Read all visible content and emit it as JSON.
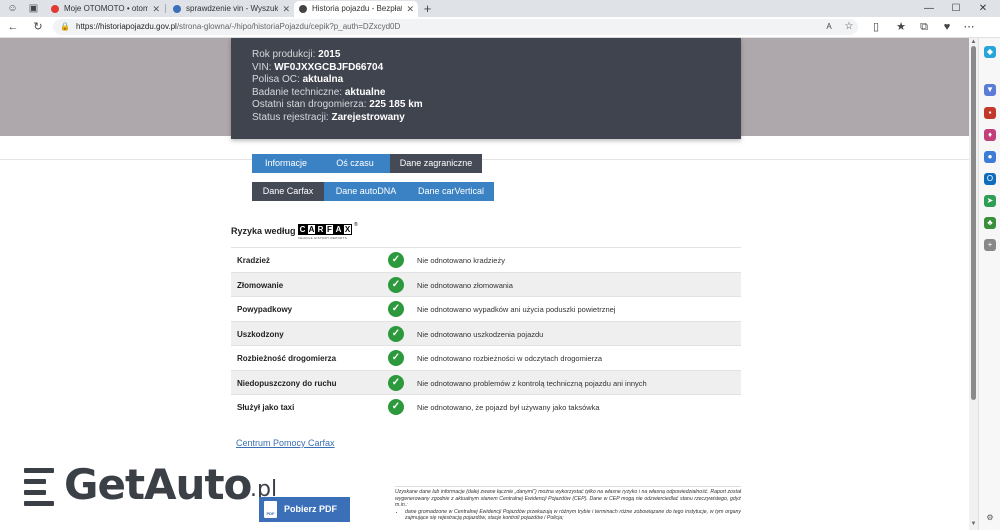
{
  "browser": {
    "tabs": [
      {
        "label": "Moje OTOMOTO • otomoto.pl",
        "fav_color": "#e23a32"
      },
      {
        "label": "sprawdzenie vin - Wyszukaj",
        "fav_color": "#3b6fb8"
      },
      {
        "label": "Historia pojazdu - Bezpłatny rap",
        "fav_color": "#444444"
      }
    ],
    "new_tab_label": "+",
    "url_host": "https://historiapojazdu.gov.pl",
    "url_path": "/strona-glowna/-/hipo/historiaPojazdu/cepik?p_auth=DZxcyd0D"
  },
  "vehicle": {
    "rok_label": "Rok produkcji:",
    "rok_value": "2015",
    "vin_label": "VIN:",
    "vin_value": "WF0JXXGCBJFD66704",
    "polisa_label": "Polisa OC:",
    "polisa_value": "aktualna",
    "badanie_label": "Badanie techniczne:",
    "badanie_value": "aktualne",
    "licznik_label": "Ostatni stan drogomierza:",
    "licznik_value": "225 185 km",
    "status_label": "Status rejestracji:",
    "status_value": "Zarejestrowany"
  },
  "tabs_row1": [
    "Informacje",
    "Oś czasu",
    "Dane zagraniczne"
  ],
  "tabs_row2": [
    "Dane Carfax",
    "Dane autoDNA",
    "Dane carVertical"
  ],
  "risk": {
    "title": "Ryzyka według",
    "carfax_letters": [
      "C",
      "A",
      "R",
      "F",
      "A",
      "X"
    ],
    "carfax_sub": "VEHICLE HISTORY REPORTS",
    "carfax_reg": "®",
    "rows": [
      {
        "name": "Kradzież",
        "desc": "Nie odnotowano kradzieży"
      },
      {
        "name": "Złomowanie",
        "desc": "Nie odnotowano złomowania"
      },
      {
        "name": "Powypadkowy",
        "desc": "Nie odnotowano wypadków ani użycia poduszki powietrznej"
      },
      {
        "name": "Uszkodzony",
        "desc": "Nie odnotowano uszkodzenia pojazdu"
      },
      {
        "name": "Rozbieżność drogomierza",
        "desc": "Nie odnotowano rozbieżności w odczytach drogomierza"
      },
      {
        "name": "Niedopuszczony do ruchu",
        "desc": "Nie odnotowano problemów z kontrolą techniczną pojazdu ani innych"
      },
      {
        "name": "Służył jako taxi",
        "desc": "Nie odnotowano, że pojazd był używany jako taksówka"
      }
    ],
    "check_glyph": "✓"
  },
  "help_link": "Centrum Pomocy Carfax",
  "logo": {
    "text": "GetAuto",
    "suffix": ".pl"
  },
  "pdf": {
    "label": "Pobierz PDF",
    "icon_text": "PDF"
  },
  "disclaimer": {
    "p1": "Uzyskane dane lub informacje (dalej zwane łącznie „danymi\") można wykorzystać tylko na własne ryzyko i na własną odpowiedzialność. Raport został wygenerowany zgodnie z aktualnym stanem Centralnej Ewidencji Pojazdów (CEP). Dane w CEP mogą nie odzwierciedlać stanu rzeczywistego, gdyż m.in.:",
    "li1": "dane gromadzone w Centralnej Ewidencji Pojazdów przekazują w różnym trybie i terminach różne zobowiązane do tego instytucje, w tym organy zajmujące się rejestracją pojazdów, stacje kontroli pojazdów i Policja;"
  }
}
